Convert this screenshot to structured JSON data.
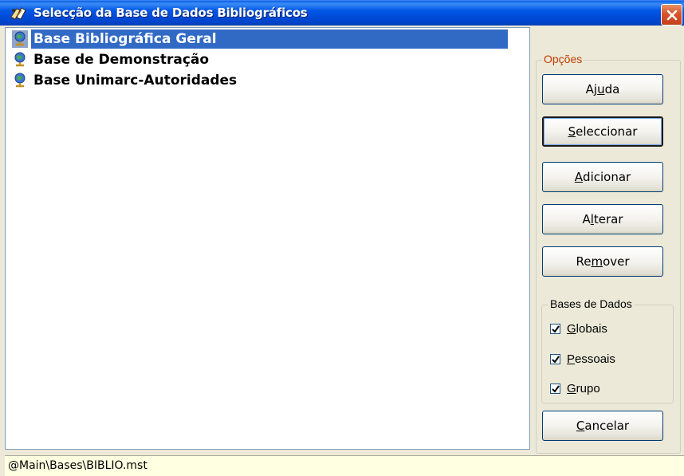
{
  "window": {
    "title": "Selecção da Base de Dados Bibliográficos"
  },
  "list": {
    "items": [
      {
        "label": "Base Bibliográfica Geral",
        "selected": true
      },
      {
        "label": "Base de Demonstração",
        "selected": false
      },
      {
        "label": "Base Unimarc-Autoridades",
        "selected": false
      }
    ]
  },
  "options": {
    "group_label": "Opções",
    "group_label_color": "#c03c00",
    "buttons": {
      "help": {
        "pre": "Aj",
        "u": "u",
        "post": "da"
      },
      "select": {
        "pre": "",
        "u": "S",
        "post": "eleccionar"
      },
      "add": {
        "pre": "",
        "u": "A",
        "post": "dicionar"
      },
      "edit": {
        "pre": "A",
        "u": "l",
        "post": "terar"
      },
      "remove": {
        "pre": "Re",
        "u": "m",
        "post": "over"
      },
      "cancel": {
        "pre": "",
        "u": "C",
        "post": "ancelar"
      }
    }
  },
  "databases": {
    "group_label": "Bases de Dados",
    "checkboxes": [
      {
        "u": "G",
        "post": "lobais",
        "checked": true
      },
      {
        "u": "P",
        "post": "essoais",
        "checked": true
      },
      {
        "u": "G",
        "post": "rupo",
        "checked": true
      }
    ]
  },
  "statusbar": {
    "path": "@Main\\Bases\\BIBLIO.mst"
  },
  "colors": {
    "title_bar": "#0055e5",
    "selection": "#316ac5",
    "status_bg": "#ffffe1"
  },
  "icons": {
    "app": "books-icon",
    "db": "globe-db-icon",
    "close": "close-icon"
  }
}
